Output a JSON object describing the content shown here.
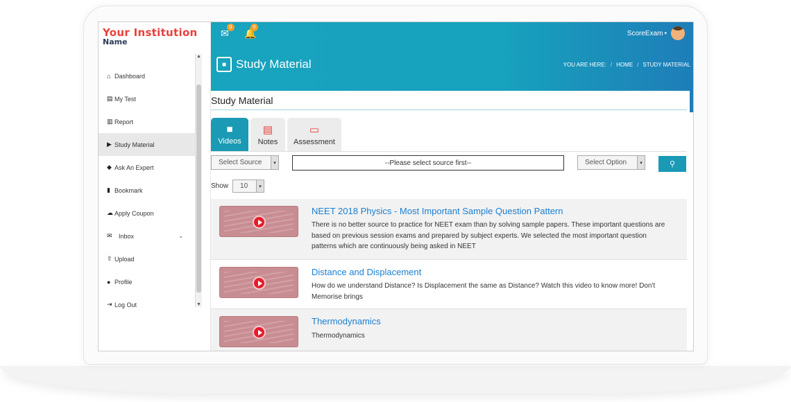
{
  "logo": {
    "line1": "Your Institution",
    "line2": "Name"
  },
  "sidebar": {
    "items": [
      {
        "icon": "home-icon",
        "glyph": "⌂",
        "label": "Dashboard"
      },
      {
        "icon": "list-icon",
        "glyph": "▤",
        "label": "My Test"
      },
      {
        "icon": "bar-chart-icon",
        "glyph": "▥",
        "label": "Report"
      },
      {
        "icon": "video-icon",
        "glyph": "▶",
        "label": "Study Material"
      },
      {
        "icon": "graduation-cap-icon",
        "glyph": "◆",
        "label": "Ask An Expert"
      },
      {
        "icon": "bookmark-icon",
        "glyph": "▮",
        "label": "Bookmark"
      },
      {
        "icon": "cloud-icon",
        "glyph": "☁",
        "label": "Apply Coupon"
      },
      {
        "icon": "envelope-icon",
        "glyph": "✉",
        "label": "Inbox"
      },
      {
        "icon": "upload-icon",
        "glyph": "⇧",
        "label": "Upload"
      },
      {
        "icon": "user-icon",
        "glyph": "●",
        "label": "Profile"
      },
      {
        "icon": "logout-icon",
        "glyph": "⇥",
        "label": "Log Out"
      }
    ],
    "active_index": 3
  },
  "header": {
    "mail_count": "0",
    "notif_count": "0",
    "username": "ScoreExam",
    "page_title": "Study Material",
    "breadcrumb": {
      "prefix": "YOU ARE HERE:",
      "home": "HOME",
      "current": "STUDY MATERIAL"
    }
  },
  "card": {
    "title": "Study Material",
    "tabs": [
      {
        "icon": "video-icon",
        "glyph": "■",
        "label": "Videos"
      },
      {
        "icon": "document-icon",
        "glyph": "▤",
        "label": "Notes"
      },
      {
        "icon": "monitor-icon",
        "glyph": "▭",
        "label": "Assessment"
      }
    ],
    "active_tab": 0,
    "filters": {
      "source_value": "Select Source",
      "source_text": "--Please select source first--",
      "option_value": "Select Option"
    },
    "show_label": "Show",
    "show_value": "10"
  },
  "videos": [
    {
      "title": "NEET 2018 Physics - Most Important Sample Question Pattern",
      "description": "There is no better source to practice for NEET exam than by solving sample papers. These important questions are based on previous session exams and prepared by subject experts. We selected the most important question patterns which are continuously being asked in NEET"
    },
    {
      "title": "Distance and Displacement",
      "description": "How do we understand Distance? Is Displacement the same as Distance? Watch this video to know more! Don't Memorise brings"
    },
    {
      "title": "Thermodynamics",
      "description": "Thermodynamics"
    }
  ],
  "colors": {
    "accent": "#1a9ab4",
    "brand_red": "#e9403a",
    "link": "#1a7fd1"
  }
}
